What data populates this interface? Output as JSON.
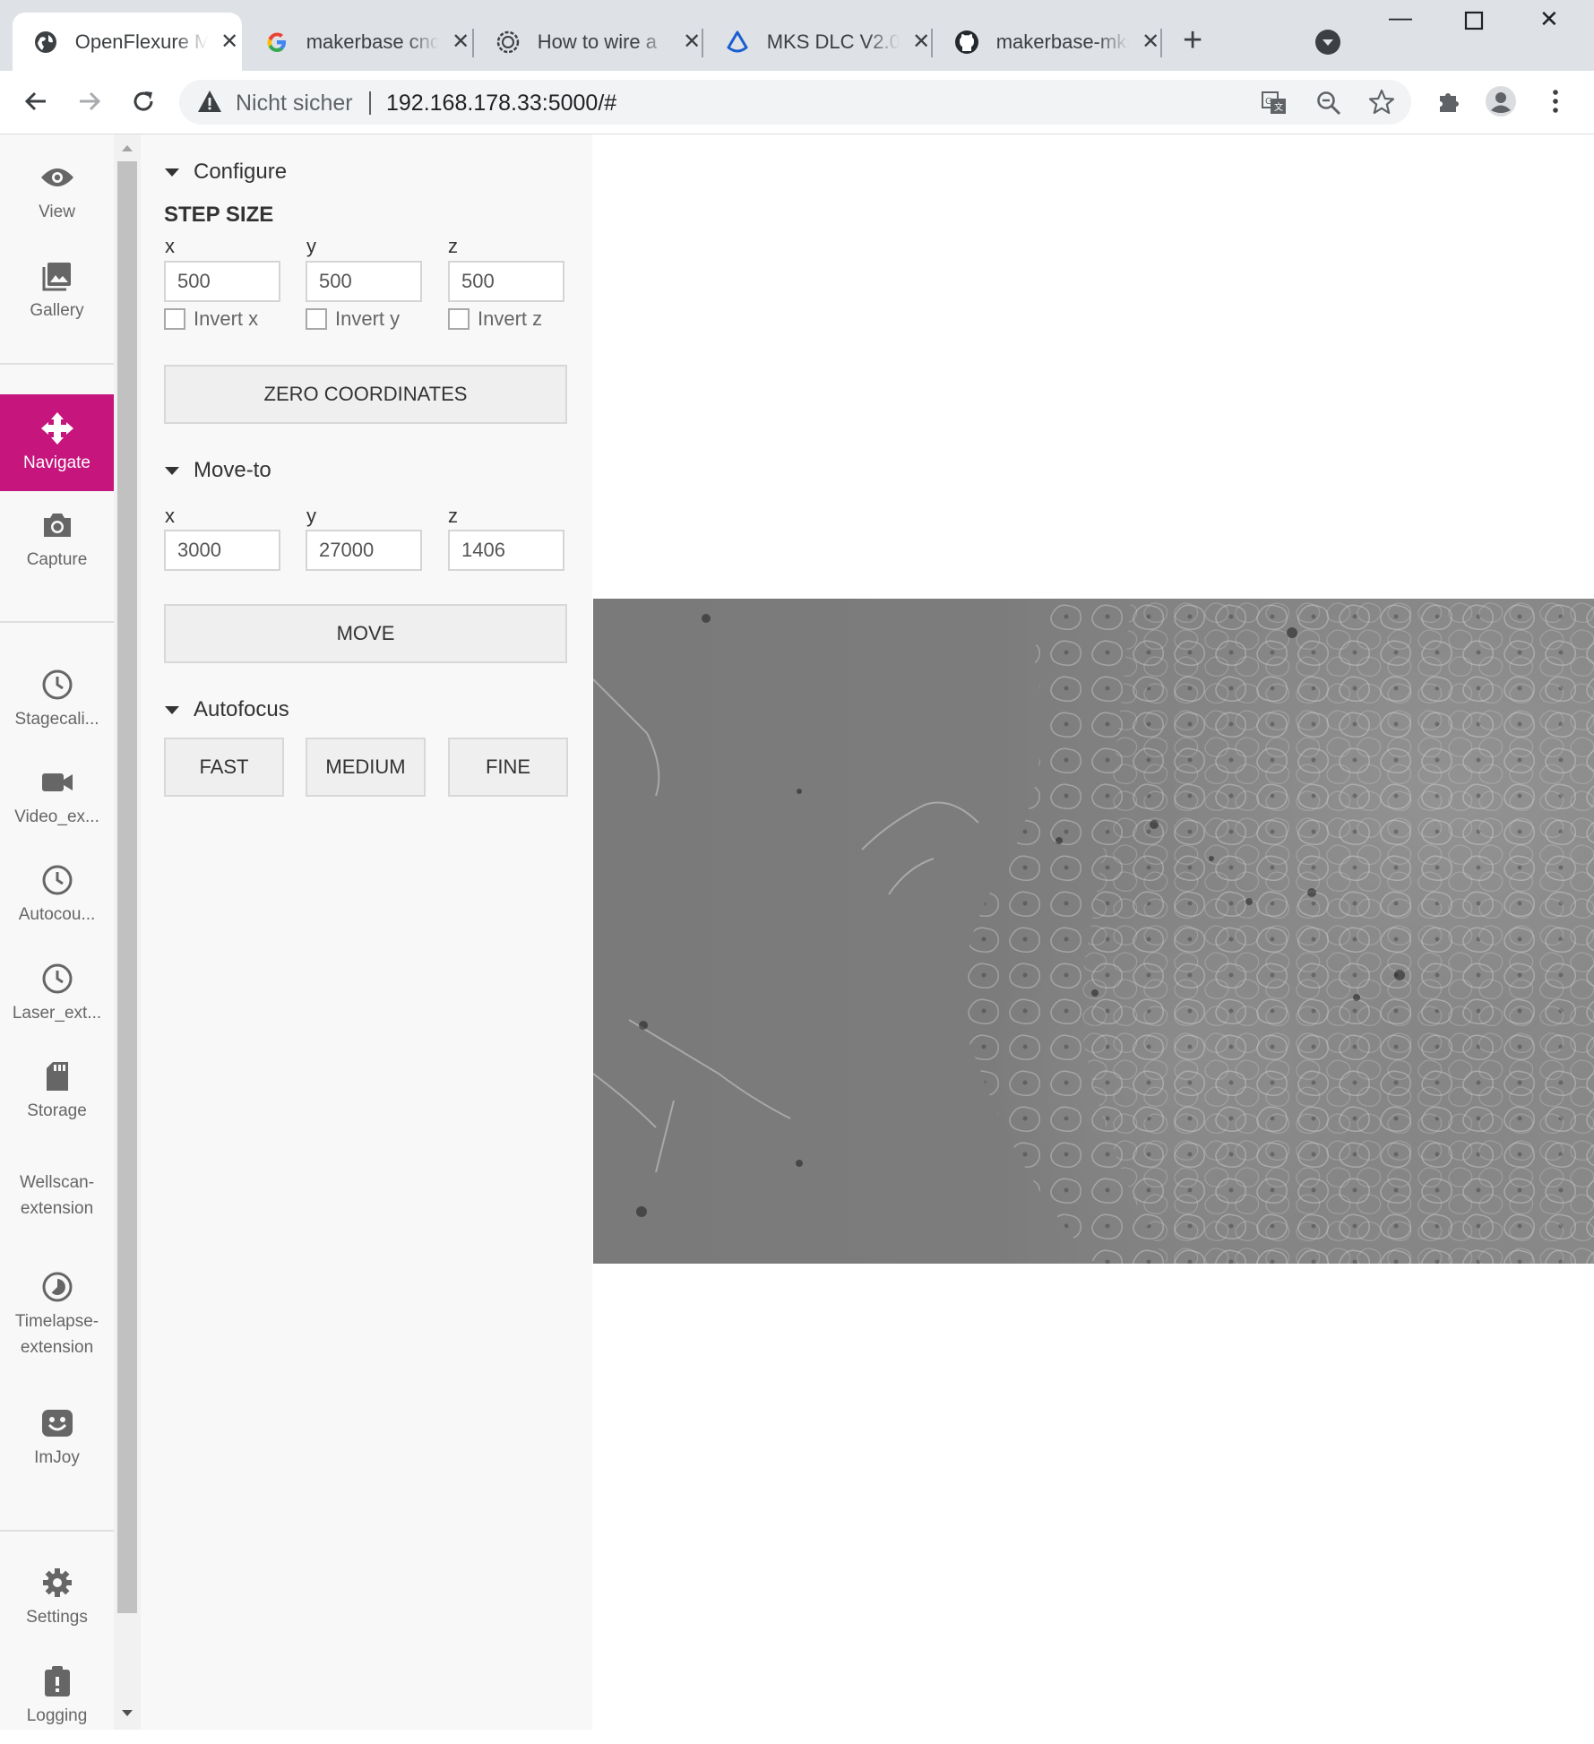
{
  "browser": {
    "tabs": [
      {
        "title": "OpenFlexure M",
        "icon": "globe-icon",
        "active": true
      },
      {
        "title": "makerbase cnc",
        "icon": "google-icon",
        "active": false
      },
      {
        "title": "How to wire a",
        "icon": "gear-site-icon",
        "active": false
      },
      {
        "title": "MKS DLC V2.0",
        "icon": "drop-icon",
        "active": false
      },
      {
        "title": "makerbase-mks",
        "icon": "github-icon",
        "active": false
      }
    ],
    "new_tab": "+",
    "address": {
      "security_label": "Nicht sicher",
      "url": "192.168.178.33:5000/#"
    }
  },
  "sidebar": {
    "items": [
      {
        "label": "View",
        "icon": "eye-icon"
      },
      {
        "label": "Gallery",
        "icon": "gallery-icon"
      },
      {
        "label": "Navigate",
        "icon": "move-icon",
        "active": true
      },
      {
        "label": "Capture",
        "icon": "camera-icon"
      },
      {
        "label": "Stagecali...",
        "icon": "clock-icon"
      },
      {
        "label": "Video_ex...",
        "icon": "video-icon"
      },
      {
        "label": "Autocou...",
        "icon": "clock-icon"
      },
      {
        "label": "Laser_ext...",
        "icon": "clock-icon"
      },
      {
        "label": "Storage",
        "icon": "sdcard-icon"
      },
      {
        "label": "Wellscan-extension",
        "line1": "Wellscan-",
        "line2": "extension"
      },
      {
        "label": "Timelapse-extension",
        "line1": "Timelapse-",
        "line2": "extension",
        "icon": "timelapse-icon"
      },
      {
        "label": "ImJoy",
        "icon": "imjoy-icon"
      },
      {
        "label": "Settings",
        "icon": "settings-icon"
      },
      {
        "label": "Logging",
        "icon": "clipboard-icon"
      }
    ],
    "active_color": "#c6157c"
  },
  "panel": {
    "configure": {
      "heading": "Configure",
      "step_size_label": "STEP SIZE",
      "axes": [
        {
          "label": "x",
          "value": "500",
          "invert_label": "Invert x",
          "checked": false
        },
        {
          "label": "y",
          "value": "500",
          "invert_label": "Invert y",
          "checked": false
        },
        {
          "label": "z",
          "value": "500",
          "invert_label": "Invert z",
          "checked": false
        }
      ],
      "zero_button": "ZERO COORDINATES"
    },
    "move_to": {
      "heading": "Move-to",
      "axes": [
        {
          "label": "x",
          "value": "3000"
        },
        {
          "label": "y",
          "value": "27000"
        },
        {
          "label": "z",
          "value": "1406"
        }
      ],
      "move_button": "MOVE"
    },
    "autofocus": {
      "heading": "Autofocus",
      "buttons": [
        "FAST",
        "MEDIUM",
        "FINE"
      ]
    }
  }
}
